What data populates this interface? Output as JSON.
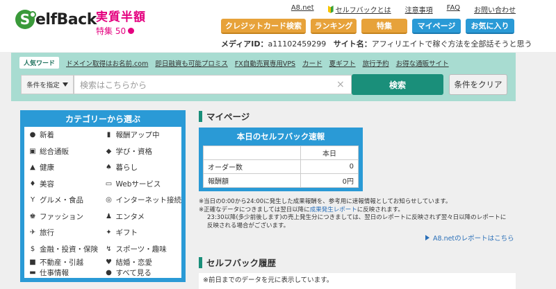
{
  "header": {
    "logo_letter": "S",
    "logo_text": "elfBack",
    "promo_main": "実質半額",
    "promo_sub": "特集 50",
    "top_links": [
      "A8.net",
      "セルフバックとは",
      "注意事項",
      "FAQ",
      "お問い合わせ"
    ],
    "nav_buttons": [
      {
        "label": "クレジットカード検索",
        "color": "orange"
      },
      {
        "label": "ランキング",
        "color": "orange"
      },
      {
        "label": "特集",
        "color": "orange"
      },
      {
        "label": "マイページ",
        "color": "blue"
      },
      {
        "label": "お気に入り",
        "color": "blue"
      }
    ],
    "media_id_label": "メディアID：",
    "media_id_value": "a11102459299",
    "site_name_label": "サイト名：",
    "site_name_value": "アフィリエイトで稼ぐ方法を全部話そうと思う"
  },
  "search": {
    "popular_label": "人気ワード",
    "popular_words": [
      "ドメイン取得はお名前.com",
      "即日融資も可能プロミス",
      "FX自動売買専用VPS",
      "カード",
      "夏ギフト",
      "旅行予約",
      "お得な通販サイト"
    ],
    "condition_label": "条件を指定",
    "placeholder": "検索はこちらから",
    "clear_symbol": "×",
    "search_button": "検索",
    "clear_button": "条件をクリア"
  },
  "categories": {
    "title": "カテゴリーから選ぶ",
    "items": [
      {
        "icon": "●",
        "label": "新着"
      },
      {
        "icon": "▮",
        "label": "報酬アップ中"
      },
      {
        "icon": "▣",
        "label": "総合通販"
      },
      {
        "icon": "◆",
        "label": "学び・資格"
      },
      {
        "icon": "▲",
        "label": "健康"
      },
      {
        "icon": "♠",
        "label": "暮らし"
      },
      {
        "icon": "♦",
        "label": "美容"
      },
      {
        "icon": "▭",
        "label": "Webサービス"
      },
      {
        "icon": "Y",
        "label": "グルメ・食品"
      },
      {
        "icon": "◎",
        "label": "インターネット接続"
      },
      {
        "icon": "♚",
        "label": "ファッション"
      },
      {
        "icon": "♟",
        "label": "エンタメ"
      },
      {
        "icon": "✈",
        "label": "旅行"
      },
      {
        "icon": "✦",
        "label": "ギフト"
      },
      {
        "icon": "$",
        "label": "金融・投資・保険"
      },
      {
        "icon": "↯",
        "label": "スポーツ・趣味"
      },
      {
        "icon": "■",
        "label": "不動産・引越"
      },
      {
        "icon": "♥",
        "label": "結婚・恋愛"
      },
      {
        "icon": "▬",
        "label": "仕事情報"
      },
      {
        "icon": "●",
        "label": "すべて見る"
      }
    ]
  },
  "mypage": {
    "title": "マイページ",
    "report_title": "本日のセルフバック速報",
    "col_header": "本日",
    "rows": [
      {
        "label": "オーダー数",
        "value": "0"
      },
      {
        "label": "報酬額",
        "value": "0円"
      }
    ],
    "note1": "※当日の0:00から24:00に発生した成果報酬を、参考用に速報情報としてお知らせしています。",
    "note2_a": "※正確なデータにつきましては翌日以降に",
    "note2_link": "成果発生レポート",
    "note2_b": "に反映されます。",
    "note3": "23:30以降(多少前後します)の売上発生分につきましては、翌日のレポートに反映されず翌々日以降のレポートに反映される場合がございます。",
    "a8_report_link": "A8.netのレポートはこちら"
  },
  "history": {
    "title": "セルフバック履歴",
    "note": "※前日までのデータを元に表示しています。"
  }
}
